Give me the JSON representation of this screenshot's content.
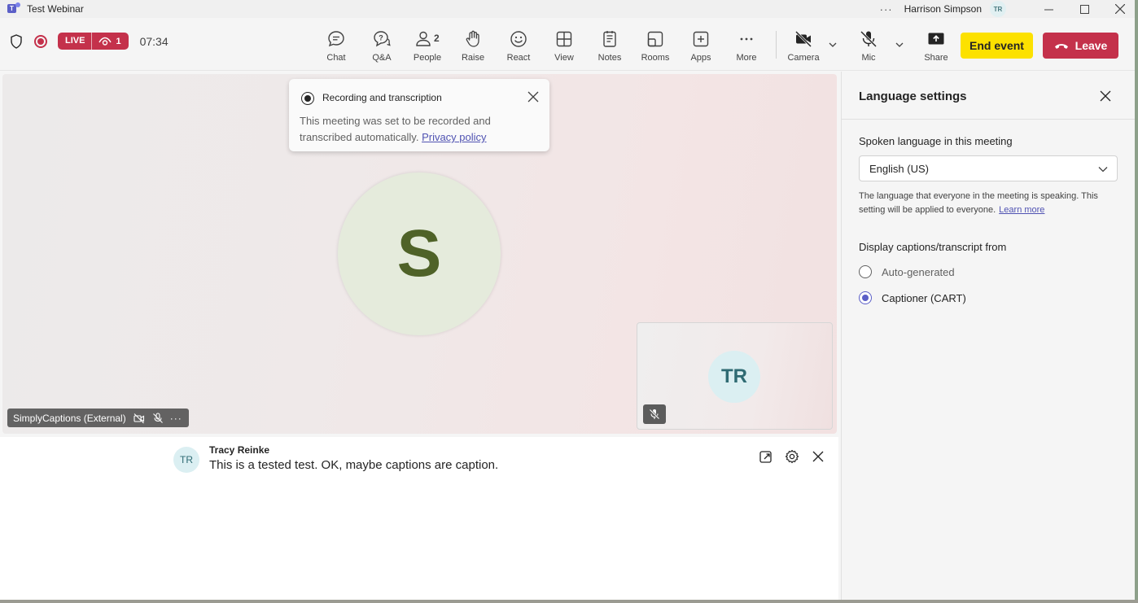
{
  "window": {
    "title": "Test Webinar",
    "user_name": "Harrison Simpson",
    "user_initials": "TR",
    "more_label": "···"
  },
  "toolbar": {
    "live_label": "LIVE",
    "viewer_count": "1",
    "timer": "07:34",
    "tools": {
      "chat": "Chat",
      "qa": "Q&A",
      "people": "People",
      "people_count": "2",
      "raise": "Raise",
      "react": "React",
      "view": "View",
      "notes": "Notes",
      "rooms": "Rooms",
      "apps": "Apps",
      "more": "More",
      "camera": "Camera",
      "mic": "Mic",
      "share": "Share"
    },
    "end_event_label": "End event",
    "leave_label": "Leave"
  },
  "notice": {
    "title": "Recording and transcription",
    "body": "This meeting was set to be recorded and transcribed automatically.",
    "link": "Privacy policy"
  },
  "stage": {
    "main_initial": "S",
    "participant_name": "SimplyCaptions (External)",
    "self_initials": "TR"
  },
  "captions": {
    "speaker_initials": "TR",
    "speaker_name": "Tracy Reinke",
    "text": "This is a tested test. OK, maybe captions are caption."
  },
  "panel": {
    "title": "Language settings",
    "spoken_label": "Spoken language in this meeting",
    "spoken_value": "English (US)",
    "help_text": "The language that everyone in the meeting is speaking. This setting will be applied to everyone.",
    "learn_more": "Learn more",
    "display_label": "Display captions/transcript from",
    "options": [
      {
        "label": "Auto-generated",
        "selected": false
      },
      {
        "label": "Captioner (CART)",
        "selected": true
      }
    ]
  },
  "colors": {
    "accent": "#5b5fc7",
    "live_red": "#c4314b",
    "end_event_yellow": "#fce100",
    "avatar_green_bg": "#e5ebdc",
    "avatar_green_fg": "#4f6228"
  }
}
